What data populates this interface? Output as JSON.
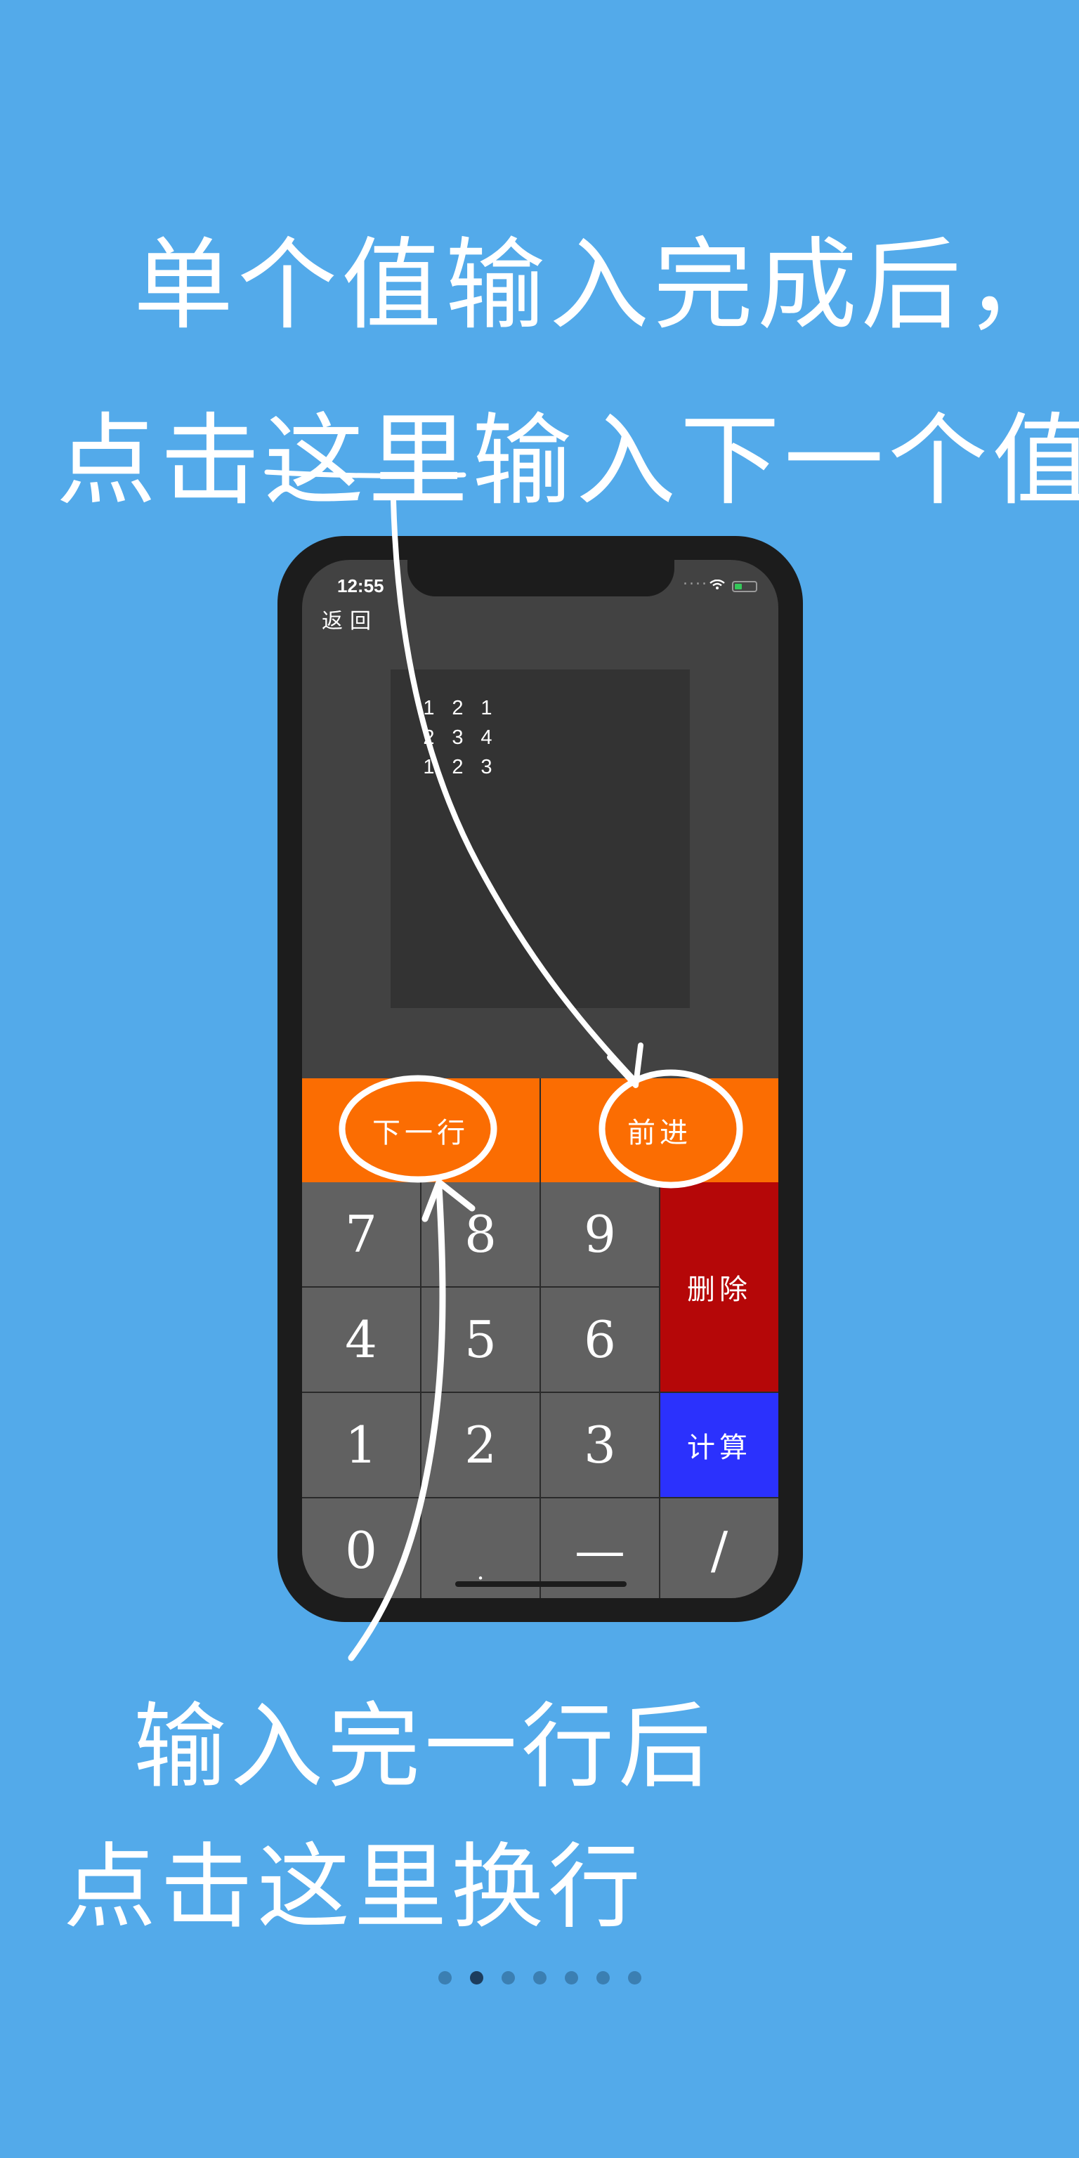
{
  "captions": {
    "top_line1": "单个值输入完成后，",
    "top_line2": "点击这里输入下一个值",
    "bottom_line1": "输入完一行后",
    "bottom_line2": "点击这里换行"
  },
  "status_bar": {
    "time": "12:55",
    "dots": "....",
    "wifi_icon": "wifi-icon",
    "battery_icon": "battery-icon"
  },
  "nav": {
    "back_label": "返回"
  },
  "matrix": {
    "rows": [
      [
        "1",
        "2",
        "1"
      ],
      [
        "2",
        "3",
        "4"
      ],
      [
        "1",
        "2",
        "3"
      ]
    ]
  },
  "actions": {
    "next_row_label": "下一行",
    "forward_label": "前进"
  },
  "keypad": {
    "keys": {
      "k7": "7",
      "k8": "8",
      "k9": "9",
      "k4": "4",
      "k5": "5",
      "k6": "6",
      "k1": "1",
      "k2": "2",
      "k3": "3",
      "k0": "0",
      "dot": ".",
      "minus": "—",
      "slash": "/"
    },
    "delete_label": "删除",
    "calc_label": "计算"
  },
  "pagination": {
    "total": 7,
    "active_index": 1
  },
  "colors": {
    "background": "#53aaea",
    "orange": "#fb6d02",
    "delete_red": "#b50708",
    "calc_blue": "#2b31fd",
    "key_gray": "#616161"
  }
}
